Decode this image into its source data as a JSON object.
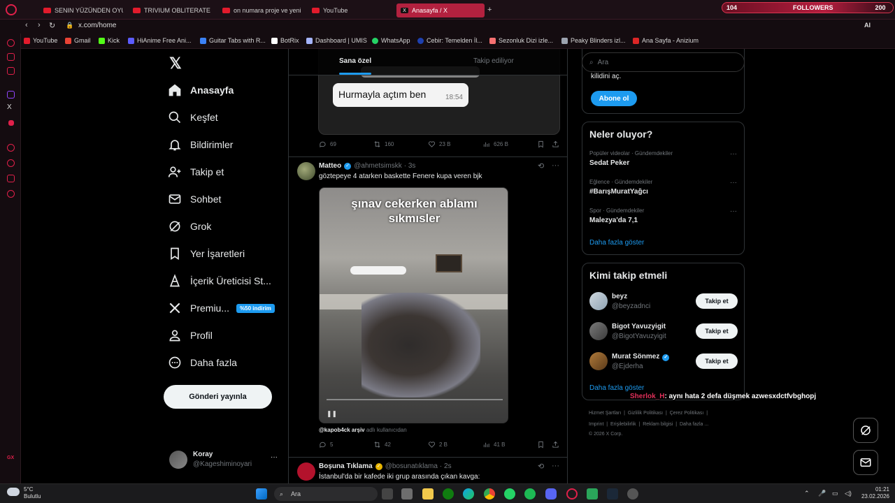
{
  "browser": {
    "tabs": [
      {
        "label": "SENIN YÜZÜNDEN OYUNC"
      },
      {
        "label": "TRIVIUM OBLITERATE"
      },
      {
        "label": "on numara proje ve yeni e"
      },
      {
        "label": "YouTube"
      },
      {
        "label": "Anasayfa / X"
      }
    ],
    "followers_widget": {
      "left": "104",
      "label": "FOLLOWERS",
      "right": "200"
    },
    "url": "x.com/home",
    "bookmarks": [
      {
        "label": "YouTube",
        "color": "#e21b2c"
      },
      {
        "label": "Gmail",
        "color": "#ea4335"
      },
      {
        "label": "Kick",
        "color": "#53fc18"
      },
      {
        "label": "HiAnime Free Ani...",
        "color": "#5c5cff"
      },
      {
        "label": "Guitar Tabs with R...",
        "color": "#3b82f6"
      },
      {
        "label": "BotRix",
        "color": "#ffffff"
      },
      {
        "label": "Dashboard | UMIS",
        "color": "#a5b4fc"
      },
      {
        "label": "WhatsApp",
        "color": "#25d366"
      },
      {
        "label": "Cebir: Temelden İl...",
        "color": "#1e40af"
      },
      {
        "label": "Sezonluk Dizi izle...",
        "color": "#f87171"
      },
      {
        "label": "Peaky Blinders izl...",
        "color": "#9ca3af"
      },
      {
        "label": "Ana Sayfa - Anizium",
        "color": "#dc2626"
      }
    ]
  },
  "nav": {
    "items": [
      {
        "label": "Anasayfa",
        "icon": "home-icon"
      },
      {
        "label": "Keşfet",
        "icon": "search-icon"
      },
      {
        "label": "Bildirimler",
        "icon": "bell-icon"
      },
      {
        "label": "Takip et",
        "icon": "person-add-icon"
      },
      {
        "label": "Sohbet",
        "icon": "mail-icon"
      },
      {
        "label": "Grok",
        "icon": "grok-icon"
      },
      {
        "label": "Yer İşaretleri",
        "icon": "bookmark-icon"
      },
      {
        "label": "İçerik Üreticisi St...",
        "icon": "creator-icon"
      },
      {
        "label": "Premiu...",
        "icon": "x-logo-icon"
      },
      {
        "label": "Profil",
        "icon": "profile-icon"
      },
      {
        "label": "Daha fazla",
        "icon": "more-icon"
      }
    ],
    "premium_badge": "%50 indirim",
    "post_button": "Gönderi yayınla",
    "profile": {
      "name": "Koray",
      "handle": "@Kageshiminoyari"
    }
  },
  "feed": {
    "tabs": {
      "for_you": "Sana özel",
      "following": "Takip ediliyor"
    },
    "post1": {
      "bubble_text": "Hurmayla açtım ben",
      "bubble_time": "18:54",
      "replies": "69",
      "reposts": "160",
      "likes": "23 B",
      "views": "626 B"
    },
    "post2": {
      "name": "Matteo",
      "handle": "@ahmetsimskk",
      "time": "· 3s",
      "text": "göztepeye 4 atarken baskette Fenere kupa veren bjk",
      "video_caption_1": "şınav cekerken ablamı",
      "video_caption_2": "sıkmısler",
      "source_handle": "@kapob4ck arşiv",
      "source_suffix": "adlı kullanıcıdan",
      "replies": "5",
      "reposts": "42",
      "likes": "2 B",
      "views": "41 B"
    },
    "post3": {
      "name": "Boşuna Tıklama",
      "handle": "@bosunatıklama",
      "time": "· 2s",
      "text": "İstanbul'da bir kafede iki grup arasında çıkan kavga:"
    }
  },
  "right": {
    "search_placeholder": "Ara",
    "subscribe": {
      "text": "kilidini aç.",
      "button": "Abone ol"
    },
    "trends": {
      "title": "Neler oluyor?",
      "items": [
        {
          "category": "Popüler videolar · Gündemdekiler",
          "name": "Sedat Peker"
        },
        {
          "category": "Eğlence · Gündemdekiler",
          "name": "#BarışMuratYağcı"
        },
        {
          "category": "Spor · Gündemdekiler",
          "name": "Malezya'da 7,1"
        }
      ],
      "show_more": "Daha fazla göster"
    },
    "who_to_follow": {
      "title": "Kimi takip etmeli",
      "items": [
        {
          "name": "beyz",
          "handle": "@beyzadnci",
          "button": "Takip et"
        },
        {
          "name": "Bigot Yavuzyigit",
          "handle": "@BigotYavuzyigit",
          "button": "Takip et"
        },
        {
          "name": "Murat Sönmez",
          "handle": "@Ejderha",
          "button": "Takip et"
        }
      ],
      "show_more": "Daha fazla göster"
    },
    "footer": {
      "line1": [
        "Hizmet Şartları",
        "Gizlilik Politikası",
        "Çerez Politikası"
      ],
      "line2": [
        "Imprint",
        "Erişilebilirlik",
        "Reklam bilgisi",
        "Daha fazla ..."
      ],
      "copyright": "© 2026 X Corp."
    }
  },
  "overlay_chat": {
    "user": "Sherlok_H",
    "message": ": aynı hata 2 defa düşmek azwesxdctfvbghopj"
  },
  "taskbar": {
    "weather_temp": "5°C",
    "weather_desc": "Bulutlu",
    "search_placeholder": "Ara",
    "time": "01:21",
    "date": "23.02.2026"
  }
}
